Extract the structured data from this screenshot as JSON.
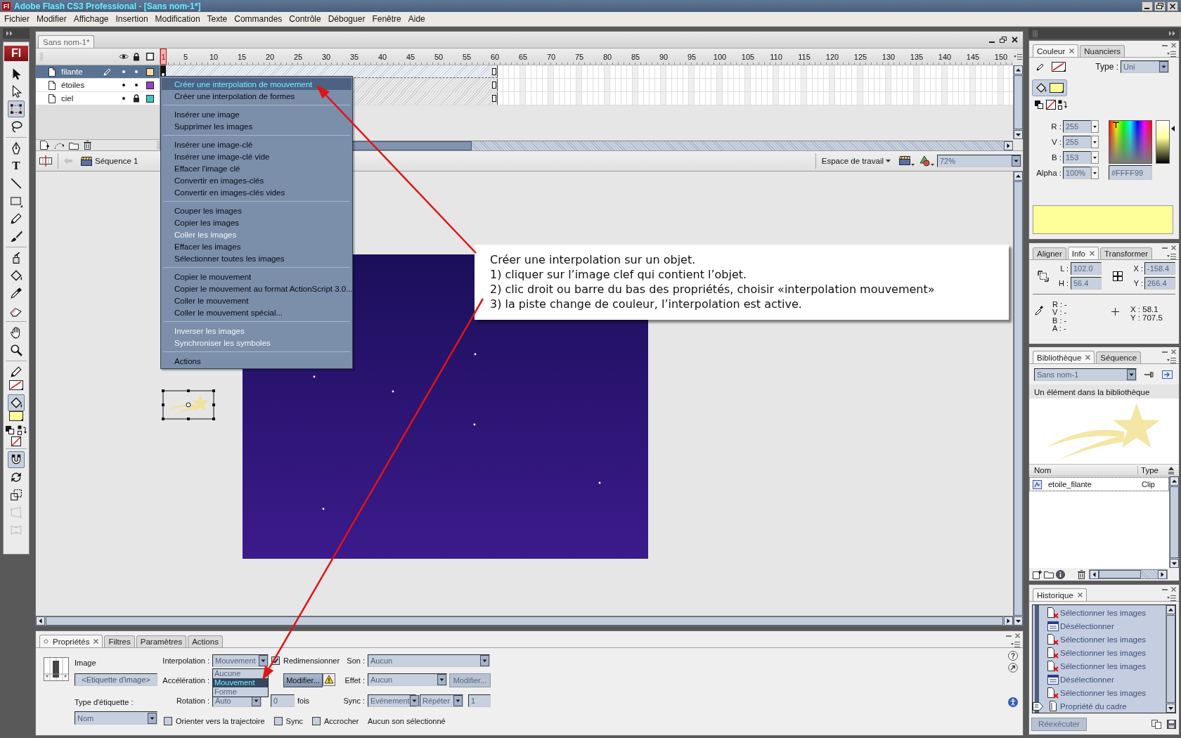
{
  "window": {
    "app_icon": "Fl",
    "title": "Adobe Flash CS3 Professional - [Sans nom-1*]"
  },
  "menu_bar": [
    "Fichier",
    "Modifier",
    "Affichage",
    "Insertion",
    "Modification",
    "Texte",
    "Commandes",
    "Contrôle",
    "Déboguer",
    "Fenêtre",
    "Aide"
  ],
  "tools": {
    "logo": "Fl",
    "groups": [
      [
        {
          "kind": "arrow",
          "selected": false
        },
        {
          "kind": "subselect",
          "selected": false
        },
        {
          "kind": "free-transform",
          "selected": true
        },
        {
          "kind": "lasso",
          "selected": false
        }
      ],
      [
        {
          "kind": "pen",
          "selected": false
        },
        {
          "kind": "text",
          "glyph": "T",
          "selected": false
        },
        {
          "kind": "line",
          "selected": false
        },
        {
          "kind": "rectangle",
          "selected": false
        },
        {
          "kind": "pencil",
          "selected": false
        },
        {
          "kind": "brush",
          "selected": false
        }
      ],
      [
        {
          "kind": "ink-bottle",
          "selected": false
        },
        {
          "kind": "paint-bucket",
          "selected": false
        },
        {
          "kind": "eyedropper",
          "selected": false
        },
        {
          "kind": "eraser",
          "selected": false
        }
      ],
      [
        {
          "kind": "hand",
          "selected": false
        },
        {
          "kind": "zoom",
          "selected": false
        }
      ],
      [
        {
          "kind": "stroke-color",
          "selected": false,
          "no_color": true
        },
        {
          "kind": "fill-color",
          "selected": true,
          "no_color": false
        },
        {
          "kind": "default-colors",
          "selected": false
        },
        {
          "kind": "swap-colors",
          "selected": false
        },
        {
          "kind": "no-color",
          "selected": false
        }
      ],
      [
        {
          "kind": "snap",
          "selected": true,
          "disabled": false
        },
        {
          "kind": "rotate-skew",
          "selected": false,
          "disabled": false
        },
        {
          "kind": "scale",
          "selected": false,
          "disabled": false
        },
        {
          "kind": "distort",
          "selected": false,
          "disabled": true
        },
        {
          "kind": "envelope",
          "selected": false,
          "disabled": true
        }
      ]
    ]
  },
  "document": {
    "tab": "Sans nom-1*"
  },
  "timeline": {
    "ruler": [
      {
        "label": "1",
        "selected": true
      },
      {
        "label": "5",
        "selected": false
      },
      {
        "label": "10",
        "selected": false
      },
      {
        "label": "15",
        "selected": false
      },
      {
        "label": "20",
        "selected": false
      },
      {
        "label": "25",
        "selected": false
      },
      {
        "label": "30",
        "selected": false
      },
      {
        "label": "35",
        "selected": false
      },
      {
        "label": "40",
        "selected": false
      },
      {
        "label": "45",
        "selected": false
      },
      {
        "label": "50",
        "selected": false
      },
      {
        "label": "55",
        "selected": false
      },
      {
        "label": "60",
        "selected": false
      },
      {
        "label": "65",
        "selected": false
      },
      {
        "label": "70",
        "selected": false
      },
      {
        "label": "75",
        "selected": false
      },
      {
        "label": "80",
        "selected": false
      },
      {
        "label": "85",
        "selected": false
      },
      {
        "label": "90",
        "selected": false
      },
      {
        "label": "95",
        "selected": false
      },
      {
        "label": "100",
        "selected": false
      },
      {
        "label": "105",
        "selected": false
      },
      {
        "label": "110",
        "selected": false
      },
      {
        "label": "115",
        "selected": false
      },
      {
        "label": "120",
        "selected": false
      },
      {
        "label": "125",
        "selected": false
      },
      {
        "label": "130",
        "selected": false
      },
      {
        "label": "135",
        "selected": false
      },
      {
        "label": "140",
        "selected": false
      },
      {
        "label": "145",
        "selected": false
      },
      {
        "label": "150",
        "selected": false
      }
    ],
    "layers": [
      {
        "name": "filante",
        "selected": true,
        "editing": true,
        "visible": true,
        "locked": false,
        "color": "#f7dca0"
      },
      {
        "name": "étoiles",
        "selected": false,
        "editing": false,
        "visible": true,
        "locked": false,
        "color": "#9a3fc0"
      },
      {
        "name": "ciel",
        "selected": false,
        "editing": false,
        "visible": true,
        "locked": true,
        "color": "#3fc8c0"
      }
    ]
  },
  "edit_bar": {
    "scene": "Séquence 1",
    "workspace": "Espace de travail",
    "zoom": "72%"
  },
  "context_menu": {
    "groups": [
      [
        {
          "label": "Créer une interpolation de mouvement",
          "selected": true,
          "disabled": false
        },
        {
          "label": "Créer une interpolation de formes",
          "selected": false,
          "disabled": false
        }
      ],
      [
        {
          "label": "Insérer une image",
          "selected": false,
          "disabled": false
        },
        {
          "label": "Supprimer les images",
          "selected": false,
          "disabled": false
        }
      ],
      [
        {
          "label": "Insérer une image-clé",
          "selected": false,
          "disabled": false
        },
        {
          "label": "Insérer une image-clé vide",
          "selected": false,
          "disabled": false
        },
        {
          "label": "Effacer l'image clé",
          "selected": false,
          "disabled": false
        },
        {
          "label": "Convertir en images-clés",
          "selected": false,
          "disabled": false
        },
        {
          "label": "Convertir en images-clés vides",
          "selected": false,
          "disabled": false
        }
      ],
      [
        {
          "label": "Couper les images",
          "selected": false,
          "disabled": false
        },
        {
          "label": "Copier les images",
          "selected": false,
          "disabled": false
        },
        {
          "label": "Coller les images",
          "selected": false,
          "disabled": true
        },
        {
          "label": "Effacer les images",
          "selected": false,
          "disabled": false
        },
        {
          "label": "Sélectionner toutes les images",
          "selected": false,
          "disabled": false
        }
      ],
      [
        {
          "label": "Copier le mouvement",
          "selected": false,
          "disabled": false
        },
        {
          "label": "Copier le mouvement au format ActionScript 3.0...",
          "selected": false,
          "disabled": false
        },
        {
          "label": "Coller le mouvement",
          "selected": false,
          "disabled": false
        },
        {
          "label": "Coller le mouvement spécial...",
          "selected": false,
          "disabled": false
        }
      ],
      [
        {
          "label": "Inverser les images",
          "selected": false,
          "disabled": true
        },
        {
          "label": "Synchroniser les symboles",
          "selected": false,
          "disabled": true
        }
      ],
      [
        {
          "label": "Actions",
          "selected": false,
          "disabled": false
        }
      ]
    ]
  },
  "callout": {
    "title": "Créer une interpolation sur un objet.",
    "steps": [
      "1) cliquer sur l’image clef qui contient l’objet.",
      "2) clic droit ou barre du bas des propriétés, choisir «interpolation mouvement»",
      "3) la piste change de couleur, l’interpolation est active."
    ]
  },
  "properties": {
    "tabs": [
      {
        "label": "Propriétés",
        "selected": true
      },
      {
        "label": "Filtres",
        "selected": false
      },
      {
        "label": "Paramètres",
        "selected": false
      },
      {
        "label": "Actions",
        "selected": false
      }
    ],
    "frame": {
      "title": "Image",
      "placeholder": "<Etiquette d'image>",
      "label_type_caption": "Type d'étiquette :",
      "label_type": "Nom"
    },
    "tween": {
      "caption": "Interpolation :",
      "value": "Mouvement",
      "expanded": true,
      "options": [
        {
          "label": "Aucune",
          "selected": false
        },
        {
          "label": "Mouvement",
          "selected": true
        },
        {
          "label": "Forme",
          "selected": false
        }
      ],
      "scale": {
        "label": "Redimensionner",
        "checked": true
      },
      "ease_caption": "Accélération :",
      "edit": {
        "label": "Modifier...",
        "disabled": false
      },
      "rotate_caption": "Rotation :",
      "rotate": "Auto",
      "times": "0",
      "times_unit": "fois",
      "flags": [
        {
          "label": "Orienter vers la trajectoire",
          "checked": false
        },
        {
          "label": "Sync",
          "checked": false
        },
        {
          "label": "Accrocher",
          "checked": false
        }
      ]
    },
    "sound": {
      "caption": "Son :",
      "value": "Aucun",
      "effect_caption": "Effet :",
      "effect": "Aucun",
      "edit": {
        "label": "Modifier...",
        "disabled": true
      },
      "sync_caption": "Sync :",
      "sync": "Evénement",
      "repeat": "Répéter",
      "repeat_count": "1",
      "status": "Aucun son sélectionné"
    },
    "help_glyph": "?"
  },
  "color_panel": {
    "tabs": [
      {
        "label": "Couleur",
        "selected": true
      },
      {
        "label": "Nuanciers",
        "selected": false
      }
    ],
    "stroke_none": true,
    "type_caption": "Type :",
    "type": "Uni",
    "fields": [
      {
        "label": "R :",
        "value": "255"
      },
      {
        "label": "V :",
        "value": "255"
      },
      {
        "label": "B :",
        "value": "153"
      },
      {
        "label": "Alpha :",
        "value": "100%"
      }
    ],
    "hex": "#FFFF99",
    "brightness": {
      "level": 0.8
    }
  },
  "info_panel": {
    "tabs": [
      {
        "label": "Aligner",
        "selected": false
      },
      {
        "label": "Info",
        "selected": true
      },
      {
        "label": "Transformer",
        "selected": false
      }
    ],
    "size": [
      {
        "label": "L :",
        "value": "102.0"
      },
      {
        "label": "H :",
        "value": "56.4"
      }
    ],
    "position": [
      {
        "label": "X :",
        "value": "-158.4"
      },
      {
        "label": "Y :",
        "value": "266.4"
      }
    ],
    "color_readout": [
      "R : -",
      "V : -",
      "B : -",
      "A : -"
    ],
    "cursor": [
      "X : 58.1",
      "Y : 707.5"
    ]
  },
  "library_panel": {
    "tabs": [
      {
        "label": "Bibliothèque",
        "selected": true
      },
      {
        "label": "Séquence",
        "selected": false
      }
    ],
    "document": "Sans nom-1",
    "count": "Un élément dans la bibliothèque",
    "columns": [
      "Nom",
      "Type"
    ],
    "items": [
      {
        "name": "etoile_filante",
        "type": "Clip",
        "selected": true
      }
    ]
  },
  "history_panel": {
    "tabs": [
      {
        "label": "Historique",
        "selected": true
      }
    ],
    "items": [
      {
        "label": "Sélectionner les images",
        "kind": "select",
        "current": false
      },
      {
        "label": "Désélectionner",
        "kind": "deselect",
        "current": false
      },
      {
        "label": "Sélectionner les images",
        "kind": "select",
        "current": false
      },
      {
        "label": "Sélectionner les images",
        "kind": "select",
        "current": false
      },
      {
        "label": "Sélectionner les images",
        "kind": "select",
        "current": false
      },
      {
        "label": "Désélectionner",
        "kind": "deselect",
        "current": false
      },
      {
        "label": "Sélectionner les images",
        "kind": "select",
        "current": false
      },
      {
        "label": "Propriété du cadre",
        "kind": "frame",
        "current": true
      }
    ],
    "replay": {
      "label": "Réexécuter",
      "disabled": true
    }
  }
}
